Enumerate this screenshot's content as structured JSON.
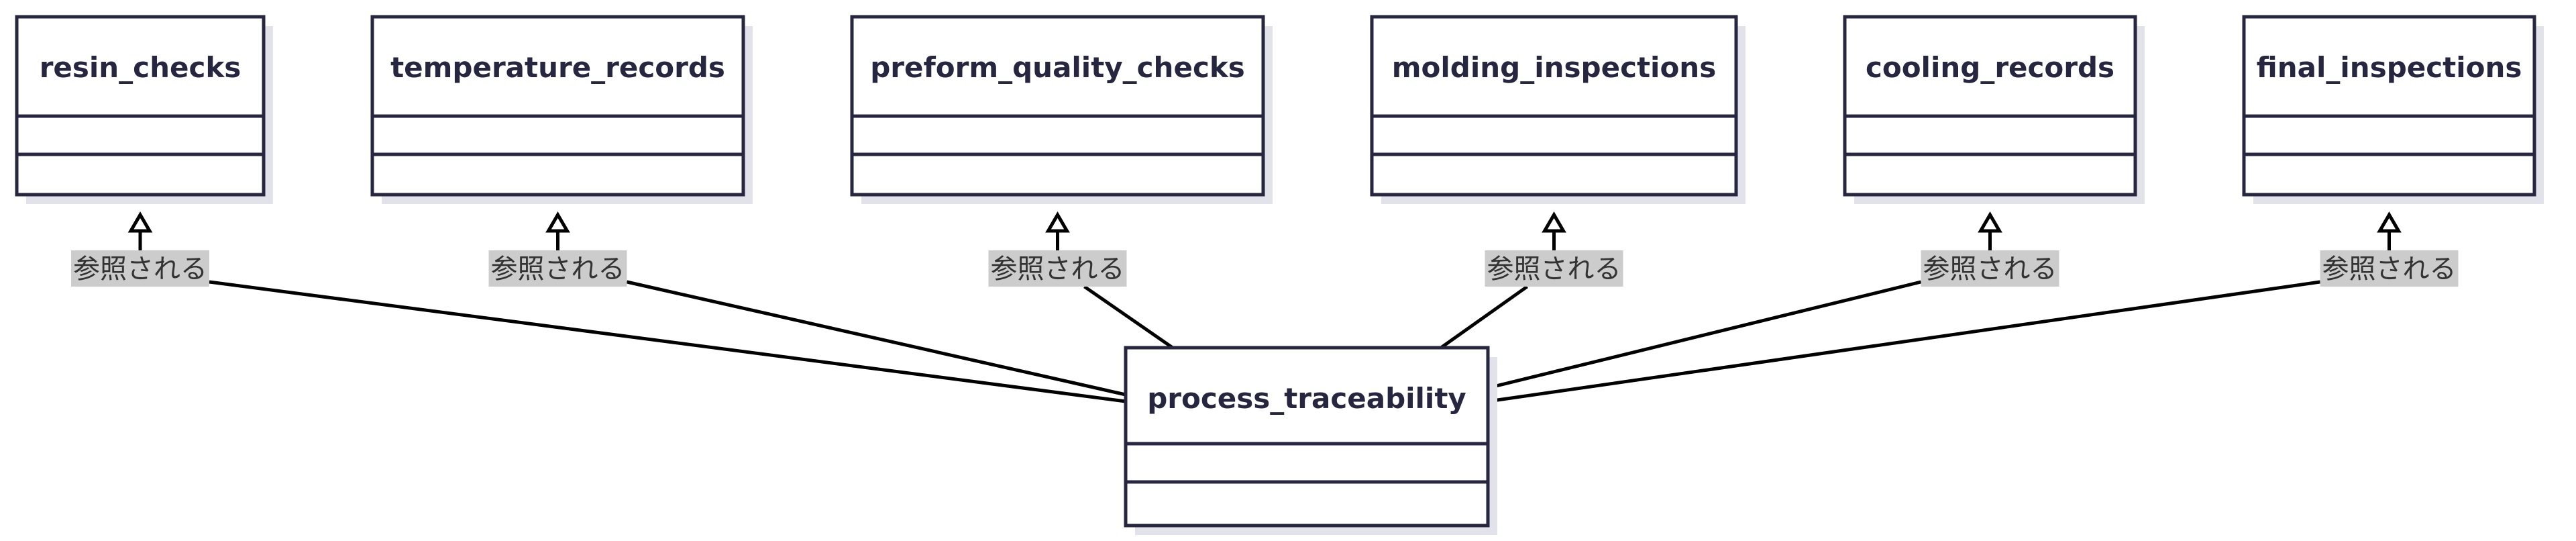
{
  "diagram": {
    "central": {
      "name": "process_traceability"
    },
    "targets": [
      {
        "name": "resin_checks",
        "relation": "参照される"
      },
      {
        "name": "temperature_records",
        "relation": "参照される"
      },
      {
        "name": "preform_quality_checks",
        "relation": "参照される"
      },
      {
        "name": "molding_inspections",
        "relation": "参照される"
      },
      {
        "name": "cooling_records",
        "relation": "参照される"
      },
      {
        "name": "final_inspections",
        "relation": "参照される"
      }
    ]
  },
  "colors": {
    "box_stroke": "#262640",
    "edge": "#000000",
    "label_background": "#cccccc",
    "label_text": "#333333"
  }
}
